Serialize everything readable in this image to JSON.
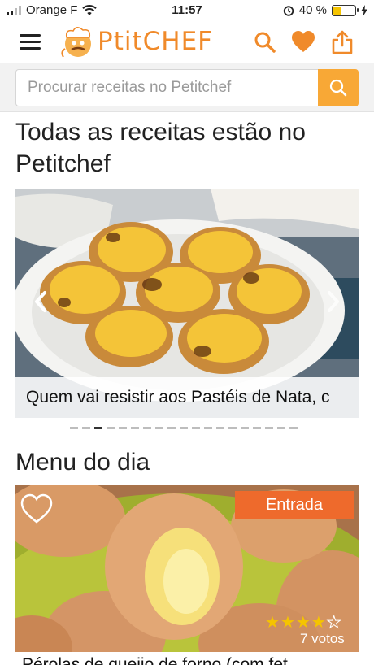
{
  "status_bar": {
    "carrier": "Orange F",
    "time": "11:57",
    "battery_percent": "40 %",
    "battery_level": 0.4
  },
  "header": {
    "logo_text": "PtitCHEF",
    "icons": [
      "menu-icon",
      "search-icon",
      "heart-icon",
      "share-icon"
    ]
  },
  "search": {
    "placeholder": "Procurar receitas no Petitchef"
  },
  "featured": {
    "title": "Todas as receitas estão no Petitchef",
    "slide_caption": "Quem vai resistir aos Pastéis de Nata, c",
    "slide_count": 19,
    "active_slide": 2
  },
  "menu_do_dia": {
    "title": "Menu do dia",
    "card": {
      "badge": "Entrada",
      "rating": 4,
      "rating_max": 5,
      "votes": "7 votos",
      "recipe_title": "Pérolas de queijo de forno (com fet"
    }
  },
  "colors": {
    "brand_orange": "#f08a2a",
    "search_button": "#f8a836",
    "badge": "#ee6a2c",
    "star": "#f5c400"
  }
}
